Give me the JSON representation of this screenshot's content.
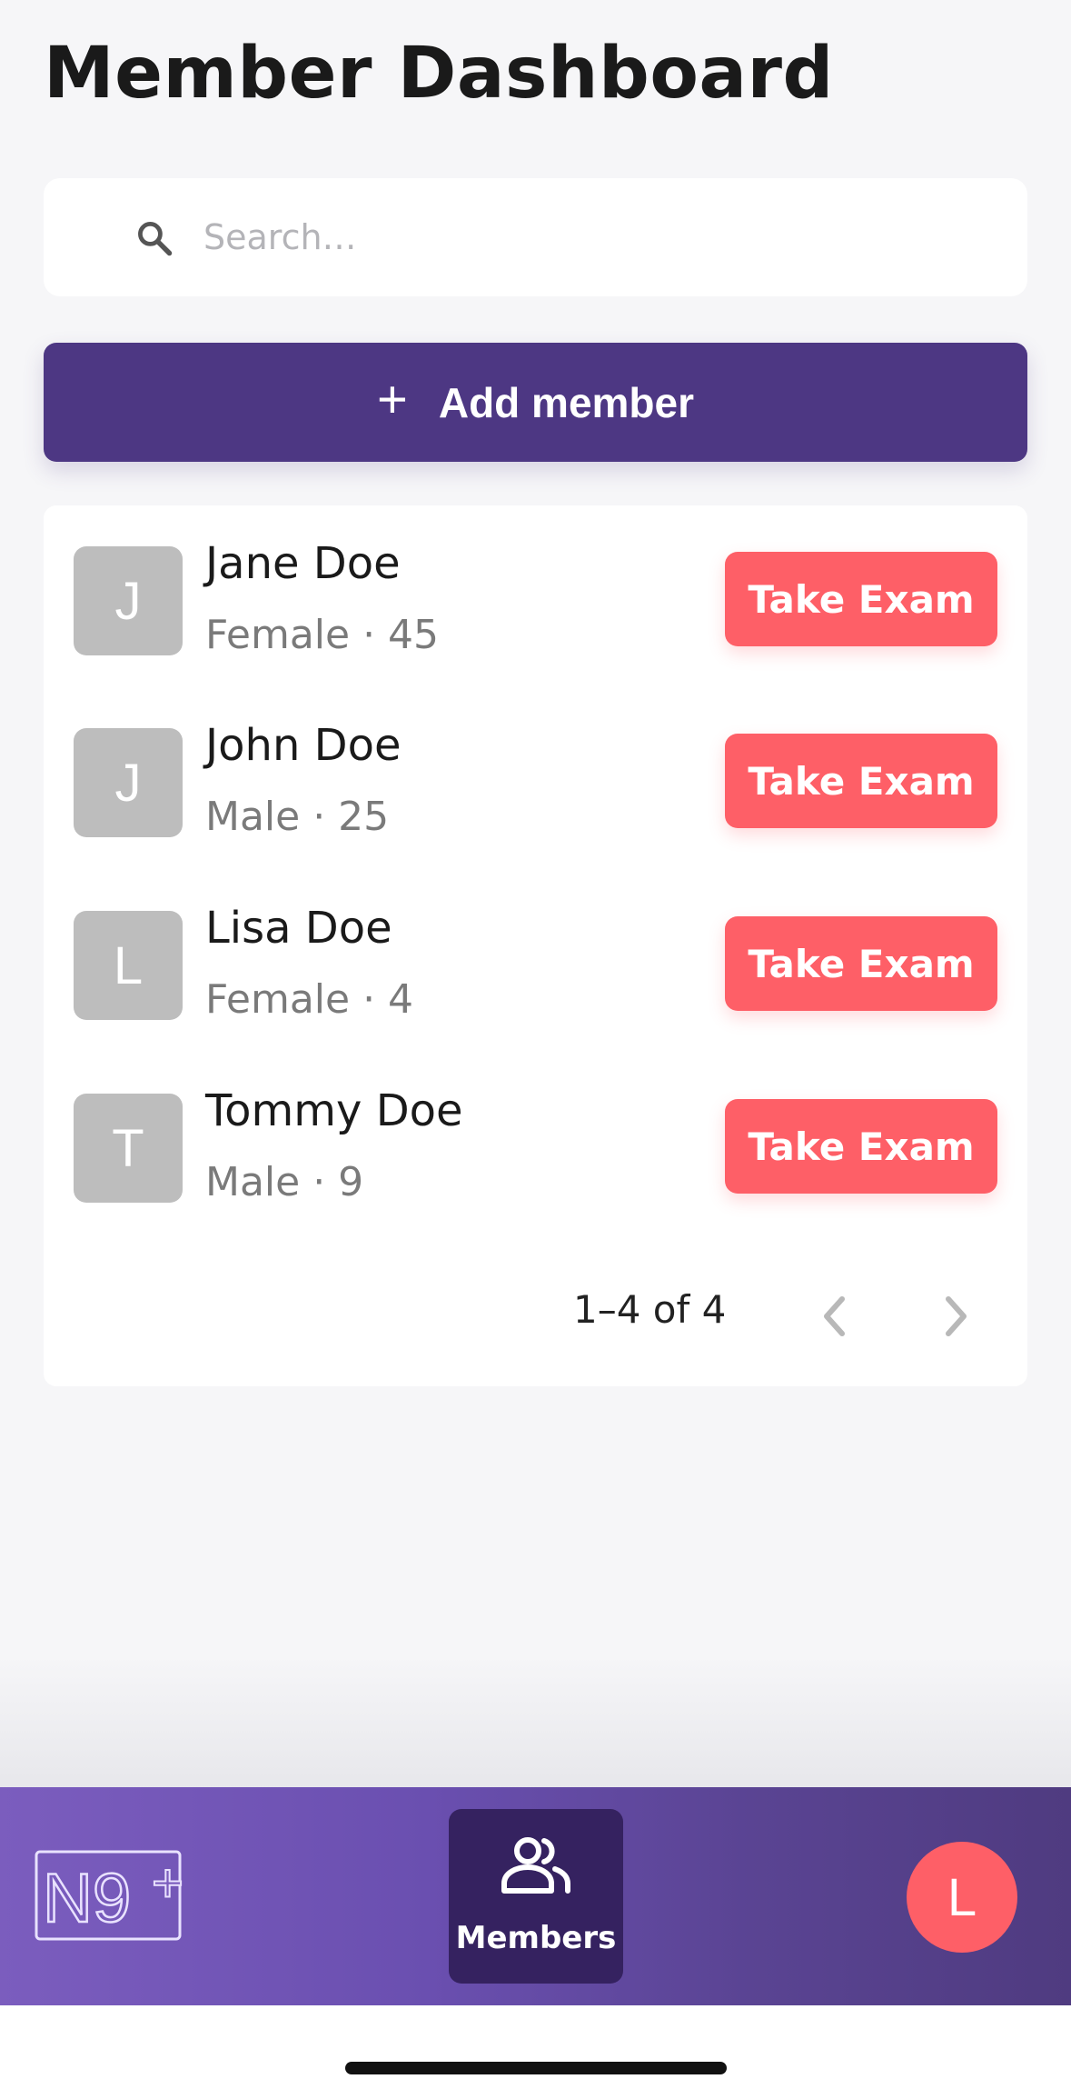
{
  "header": {
    "title": "Member Dashboard"
  },
  "search": {
    "placeholder": "Search…",
    "value": ""
  },
  "add_member": {
    "label": "Add member",
    "icon": "plus-icon"
  },
  "members": [
    {
      "initial": "J",
      "name": "Jane Doe",
      "meta": "Female · 45",
      "action": "Take Exam"
    },
    {
      "initial": "J",
      "name": "John Doe",
      "meta": "Male · 25",
      "action": "Take Exam"
    },
    {
      "initial": "L",
      "name": "Lisa Doe",
      "meta": "Female · 4",
      "action": "Take Exam"
    },
    {
      "initial": "T",
      "name": "Tommy Doe",
      "meta": "Male · 9",
      "action": "Take Exam"
    }
  ],
  "pagination": {
    "range": "1–4 of 4"
  },
  "bottom_nav": {
    "logo_text": "N9+",
    "active_tab": {
      "label": "Members",
      "icon": "people-icon"
    },
    "user_initial": "L"
  },
  "colors": {
    "primary": "#4d3783",
    "accent": "#fe5f67",
    "avatar_gray": "#bdbdbd",
    "background": "#f6f6f8"
  }
}
